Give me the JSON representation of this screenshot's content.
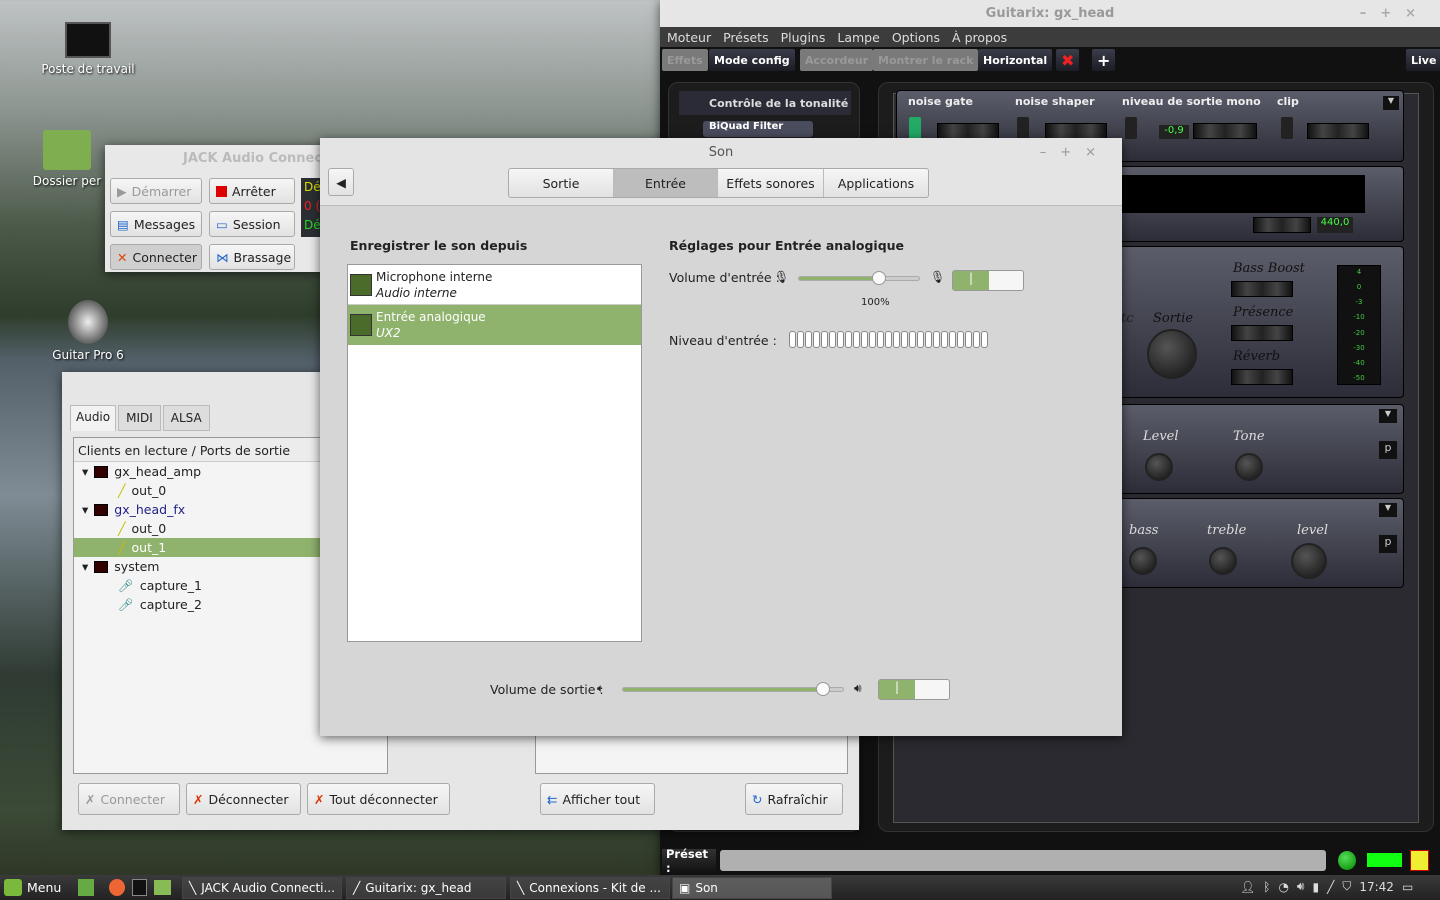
{
  "desktop": {
    "icons": [
      {
        "label": "Poste de travail"
      },
      {
        "label": "Dossier per"
      },
      {
        "label": "Guitar Pro 6"
      }
    ]
  },
  "jack_control": {
    "title": "JACK Audio Connecti",
    "buttons": {
      "start": "Démarrer",
      "stop": "Arrêter",
      "messages": "Messages",
      "session": "Session",
      "connect": "Connecter",
      "patchbay": "Brassage"
    },
    "status": [
      "Dé",
      "0 (",
      "Dé"
    ]
  },
  "jack_connections": {
    "tabs": [
      "Audio",
      "MIDI",
      "ALSA"
    ],
    "header": "Clients en lecture / Ports de sortie",
    "tree": [
      {
        "label": "gx_head_amp",
        "type": "client"
      },
      {
        "label": "out_0",
        "type": "port"
      },
      {
        "label": "gx_head_fx",
        "type": "client"
      },
      {
        "label": "out_0",
        "type": "port"
      },
      {
        "label": "out_1",
        "type": "port",
        "selected": true
      },
      {
        "label": "system",
        "type": "client"
      },
      {
        "label": "capture_1",
        "type": "capture"
      },
      {
        "label": "capture_2",
        "type": "capture"
      }
    ],
    "buttons": {
      "connect": "Connecter",
      "disconnect": "Déconnecter",
      "disconnect_all": "Tout déconnecter",
      "show_all": "Afficher tout",
      "refresh": "Rafraîchir"
    }
  },
  "guitarix": {
    "title": "Guitarix: gx_head",
    "menu": [
      "Moteur",
      "Présets",
      "Plugins",
      "Lampe",
      "Options",
      "À propos"
    ],
    "toolbar": {
      "effects": "Effets",
      "config": "Mode config",
      "tuner": "Accordeur",
      "rack": "Montrer le rack",
      "horizontal": "Horizontal",
      "live": "Live"
    },
    "left": {
      "category": "Contrôle de la tonalité",
      "plugin": "BiQuad Filter"
    },
    "mono": {
      "labels": [
        "noise gate",
        "noise shaper",
        "niveau de sortie mono",
        "clip"
      ],
      "level_value": "-0,9"
    },
    "tuner_freq": "440,0",
    "amp": {
      "output": "Sortie",
      "partial": "tc",
      "switches": [
        "Bass Boost",
        "Présence",
        "Réverb"
      ],
      "meter_ticks": [
        "4",
        "0",
        "-3",
        "-10",
        "-20",
        "-30",
        "-40",
        "-50"
      ]
    },
    "fx1": {
      "knobs": [
        "Level",
        "Tone"
      ]
    },
    "fx2": {
      "knobs": [
        "bass",
        "treble",
        "level"
      ]
    },
    "preset_label": "Préset :",
    "preset_value": ""
  },
  "son": {
    "title": "Son",
    "tabs": [
      "Sortie",
      "Entrée",
      "Effets sonores",
      "Applications"
    ],
    "active_tab": "Entrée",
    "left_heading": "Enregistrer le son depuis",
    "devices": [
      {
        "name": "Microphone interne",
        "sub": "Audio interne"
      },
      {
        "name": "Entrée analogique",
        "sub": "UX2",
        "selected": true
      }
    ],
    "right_heading": "Réglages pour Entrée analogique",
    "input_volume_label": "Volume d'entrée :",
    "input_volume": 100,
    "input_volume_text": "100%",
    "input_level_label": "Niveau d'entrée :",
    "input_level": 0,
    "output_volume_label": "Volume de sortie :",
    "output_volume": 100,
    "toggle_on": "|"
  },
  "taskbar": {
    "menu": "Menu",
    "tasks": [
      "JACK Audio Connecti...",
      "Guitarix: gx_head",
      "Connexions - Kit de ...",
      "Son"
    ],
    "clock": "17:42"
  },
  "colors": {
    "accent": "#8fb26d",
    "selected": "#8fb26d"
  }
}
